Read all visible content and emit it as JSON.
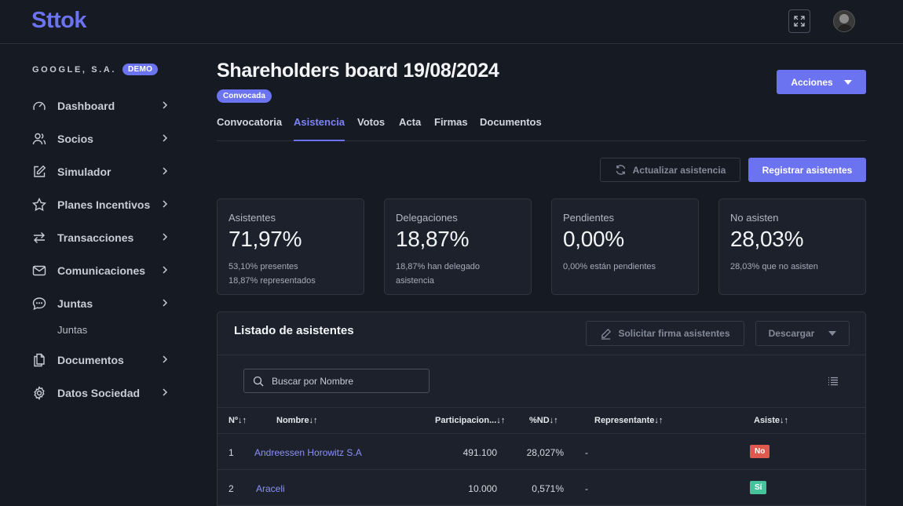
{
  "app": {
    "logo": "Sttok"
  },
  "sidebar": {
    "company": "GOOGLE, S.A.",
    "badge": "DEMO",
    "items": [
      {
        "label": "Dashboard",
        "icon": "gauge-icon"
      },
      {
        "label": "Socios",
        "icon": "users-icon"
      },
      {
        "label": "Simulador",
        "icon": "edit-icon"
      },
      {
        "label": "Planes Incentivos",
        "icon": "star-icon"
      },
      {
        "label": "Transacciones",
        "icon": "arrows-icon"
      },
      {
        "label": "Comunicaciones",
        "icon": "mail-icon"
      },
      {
        "label": "Juntas",
        "icon": "chat-icon"
      },
      {
        "label": "Documentos",
        "icon": "documents-icon"
      },
      {
        "label": "Datos Sociedad",
        "icon": "gear-icon"
      }
    ],
    "subitem": "Juntas"
  },
  "header": {
    "title": "Shareholders board 19/08/2024",
    "status": "Convocada",
    "actions_label": "Acciones"
  },
  "tabs": [
    "Convocatoria",
    "Asistencia",
    "Votos",
    "Acta",
    "Firmas",
    "Documentos"
  ],
  "active_tab": "Asistencia",
  "buttons": {
    "refresh": "Actualizar asistencia",
    "register": "Registrar asistentes",
    "request_signature": "Solicitar firma asistentes",
    "download": "Descargar"
  },
  "cards": [
    {
      "label": "Asistentes",
      "value": "71,97%",
      "sub1": "53,10% presentes",
      "sub2": "18,87% representados"
    },
    {
      "label": "Delegaciones",
      "value": "18,87%",
      "sub1": "18,87% han delegado asistencia",
      "sub2": ""
    },
    {
      "label": "Pendientes",
      "value": "0,00%",
      "sub1": "0,00% están pendientes",
      "sub2": ""
    },
    {
      "label": "No asisten",
      "value": "28,03%",
      "sub1": "28,03% que no asisten",
      "sub2": ""
    }
  ],
  "list": {
    "title": "Listado de asistentes",
    "search_placeholder": "Buscar por Nombre",
    "columns": [
      "Nº↓↑",
      "Nombre↓↑",
      "Participacion...↓↑",
      "%ND↓↑",
      "Representante↓↑",
      "Asiste↓↑"
    ],
    "rows": [
      {
        "n": "1",
        "name": "Andreessen Horowitz S.A",
        "participation": "491.100",
        "nd": "28,027%",
        "rep": "-",
        "attends": "No"
      },
      {
        "n": "2",
        "name": "Araceli",
        "participation": "10.000",
        "nd": "0,571%",
        "rep": "-",
        "attends": "Sí"
      }
    ]
  },
  "colors": {
    "accent": "#6c73f0",
    "no": "#e0594f",
    "yes": "#45c49b",
    "background": "#161a23"
  }
}
